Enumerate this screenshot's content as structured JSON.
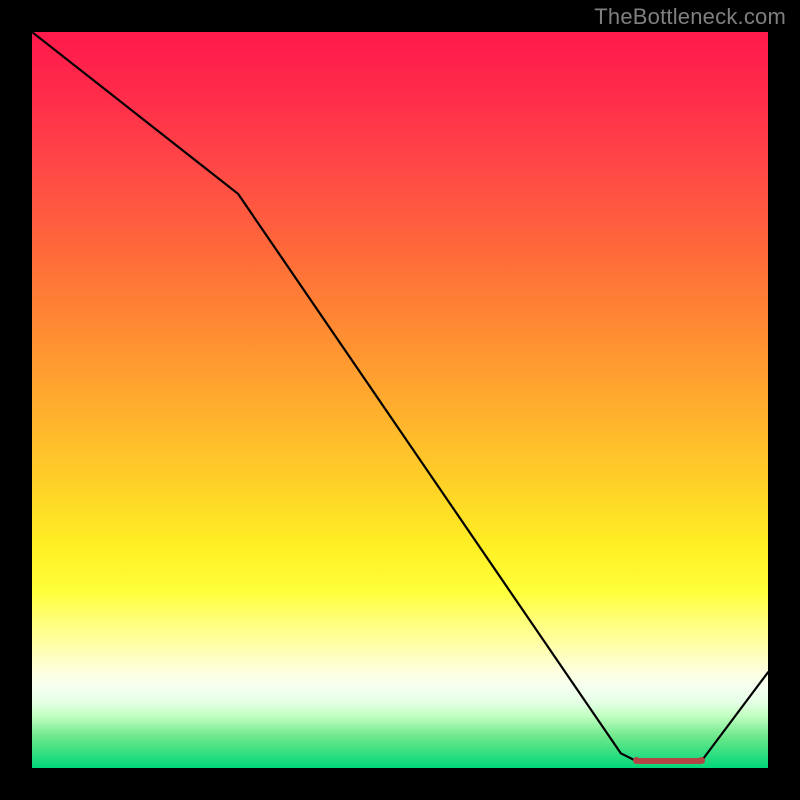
{
  "watermark": "TheBottleneck.com",
  "colors": {
    "frame": "#000000",
    "line": "#000000",
    "marker": "#b44545",
    "watermark": "#7f7f7f"
  },
  "chart_data": {
    "type": "line",
    "title": "",
    "xlabel": "",
    "ylabel": "",
    "xlim": [
      0,
      100
    ],
    "ylim": [
      0,
      100
    ],
    "grid": false,
    "legend": false,
    "x": [
      0,
      28,
      80,
      82,
      84,
      86,
      88,
      91,
      100
    ],
    "values": [
      100,
      78,
      2,
      1,
      1,
      1,
      1,
      1,
      13
    ],
    "flat_region_x": [
      82,
      91
    ],
    "note": "y expressed as percent of plot height from bottom; x as percent of plot width from left. Values read off pixel positions; no axis tick labels present in image."
  }
}
